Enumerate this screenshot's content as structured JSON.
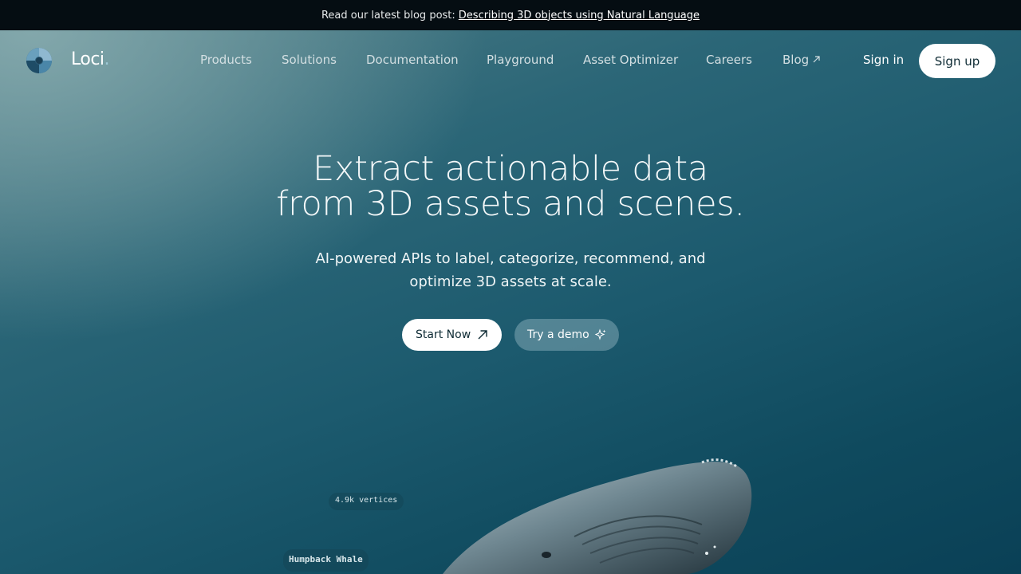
{
  "announcement": {
    "prefix": "Read our latest blog post:",
    "link": "Describing 3D objects using Natural Language"
  },
  "brand": {
    "name": "Loci",
    "dot": "."
  },
  "nav": {
    "items": [
      {
        "label": "Products"
      },
      {
        "label": "Solutions"
      },
      {
        "label": "Documentation"
      },
      {
        "label": "Playground"
      },
      {
        "label": "Asset Optimizer"
      },
      {
        "label": "Careers"
      },
      {
        "label": "Blog",
        "icon": "external-arrow-icon"
      }
    ],
    "sign_in": "Sign in",
    "sign_up": "Sign up"
  },
  "hero": {
    "headline_line1": "Extract actionable data",
    "headline_line2": "from 3D assets and scenes.",
    "subtitle_line1": "AI-powered APIs to label, categorize, recommend, and",
    "subtitle_line2": "optimize 3D assets at scale.",
    "start_button": "Start Now",
    "demo_button": "Try a demo",
    "start_icon": "arrow-up-right-icon",
    "demo_icon": "sparkle-icon"
  },
  "model_preview": {
    "vertices_tag": "4.9k vertices",
    "label_tag": "Humpback Whale"
  },
  "colors": {
    "announcement_bg": "#050d12",
    "hero_top": "#4f7d86",
    "hero_bottom": "#0a4056",
    "button_light": "#ffffff"
  }
}
